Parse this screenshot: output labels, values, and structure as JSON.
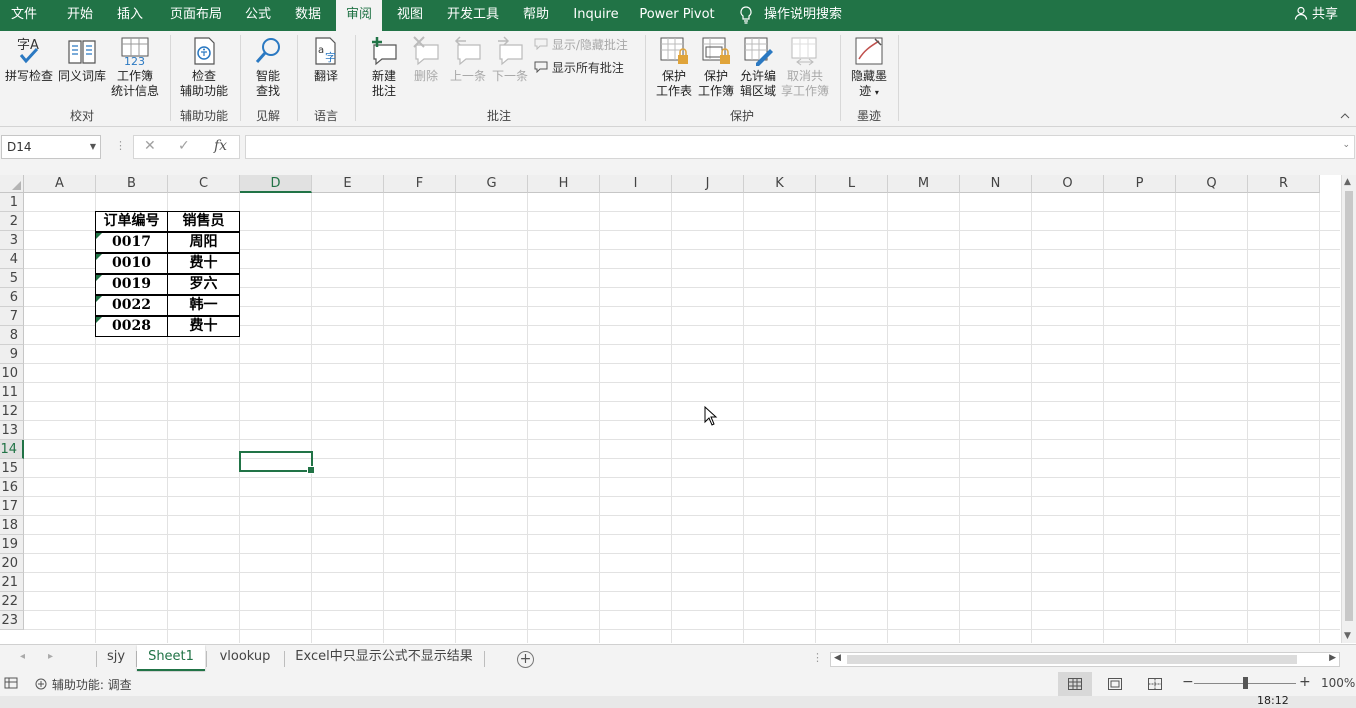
{
  "menu": {
    "file": "文件",
    "home": "开始",
    "insert": "插入",
    "layout": "页面布局",
    "formulas": "公式",
    "data": "数据",
    "review": "审阅",
    "view": "视图",
    "developer": "开发工具",
    "help": "帮助",
    "inquire": "Inquire",
    "powerpivot": "Power Pivot",
    "search": "操作说明搜索",
    "share": "共享"
  },
  "ribbon": {
    "spelling": "拼写检查",
    "thesaurus": "同义词库",
    "workbook_stats_1": "工作簿",
    "workbook_stats_2": "统计信息",
    "group_proofing": "校对",
    "check_access_1": "检查",
    "check_access_2": "辅助功能",
    "group_access": "辅助功能",
    "smart_lookup_1": "智能",
    "smart_lookup_2": "查找",
    "group_insights": "见解",
    "translate": "翻译",
    "group_language": "语言",
    "new_comment_1": "新建",
    "new_comment_2": "批注",
    "delete": "删除",
    "previous": "上一条",
    "next": "下一条",
    "show_hide": "显示/隐藏批注",
    "show_all": "显示所有批注",
    "group_comments": "批注",
    "protect_sheet_1": "保护",
    "protect_sheet_2": "工作表",
    "protect_wb_1": "保护",
    "protect_wb_2": "工作簿",
    "allow_edit_1": "允许编",
    "allow_edit_2": "辑区域",
    "unshare_1": "取消共",
    "unshare_2": "享工作簿",
    "group_protect": "保护",
    "hide_ink_1": "隐藏墨",
    "hide_ink_2": "迹",
    "group_ink": "墨迹"
  },
  "formula_bar": {
    "name_box": "D14",
    "cancel": "✕",
    "enter": "✓",
    "fx": "fx",
    "formula": ""
  },
  "columns": [
    "A",
    "B",
    "C",
    "D",
    "E",
    "F",
    "G",
    "H",
    "I",
    "J",
    "K",
    "L",
    "M",
    "N",
    "O",
    "P",
    "Q",
    "R"
  ],
  "rows": [
    "1",
    "2",
    "3",
    "4",
    "5",
    "6",
    "7",
    "8",
    "9",
    "10",
    "11",
    "12",
    "13",
    "14",
    "15",
    "16",
    "17",
    "18",
    "19",
    "20",
    "21",
    "22",
    "23"
  ],
  "table": {
    "header": [
      "订单编号",
      "销售员"
    ],
    "rows": [
      [
        "0017",
        "周阳"
      ],
      [
        "0010",
        "费十"
      ],
      [
        "0019",
        "罗六"
      ],
      [
        "0022",
        "韩一"
      ],
      [
        "0028",
        "费十"
      ]
    ]
  },
  "sheets": [
    "sjy",
    "Sheet1",
    "vlookup",
    "Excel中只显示公式不显示结果"
  ],
  "active_sheet": "Sheet1",
  "status": {
    "accessibility": "辅助功能: 调查",
    "zoom": "100%",
    "zoom_level": 1.0,
    "time": "18:12"
  },
  "colors": {
    "accent": "#217346"
  }
}
